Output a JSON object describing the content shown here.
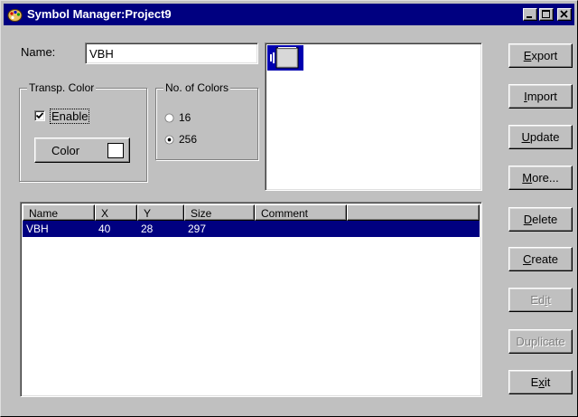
{
  "window": {
    "title": "Symbol Manager:Project9"
  },
  "form": {
    "name_label": "Name:",
    "name_value": "VBH",
    "transp_group_title": "Transp. Color",
    "enable_label": "Enable",
    "enable_checked": true,
    "color_button": "Color",
    "colors_group_title": "No. of Colors",
    "color_options": [
      "16",
      "256"
    ],
    "selected_colors": "256"
  },
  "buttons": {
    "export": {
      "pre": "",
      "key": "E",
      "post": "xport"
    },
    "import": {
      "pre": "",
      "key": "I",
      "post": "mport"
    },
    "update": {
      "pre": "",
      "key": "U",
      "post": "pdate"
    },
    "more": {
      "pre": "",
      "key": "M",
      "post": "ore..."
    },
    "delete": {
      "pre": "",
      "key": "D",
      "post": "elete"
    },
    "create": {
      "pre": "",
      "key": "C",
      "post": "reate"
    },
    "edit": {
      "pre": "Ed",
      "key": "i",
      "post": "t",
      "disabled": true
    },
    "duplicate": {
      "pre": "Duplicate",
      "key": "",
      "post": "",
      "disabled": true
    },
    "exit": {
      "pre": "E",
      "key": "x",
      "post": "it"
    }
  },
  "table": {
    "columns": [
      "Name",
      "X",
      "Y",
      "Size",
      "Comment"
    ],
    "rows": [
      {
        "name": "VBH",
        "x": "40",
        "y": "28",
        "size": "297",
        "comment": "",
        "selected": true
      }
    ]
  },
  "colors": {
    "title_bar": "#000080",
    "selection": "#000080",
    "face": "#c0c0c0"
  }
}
